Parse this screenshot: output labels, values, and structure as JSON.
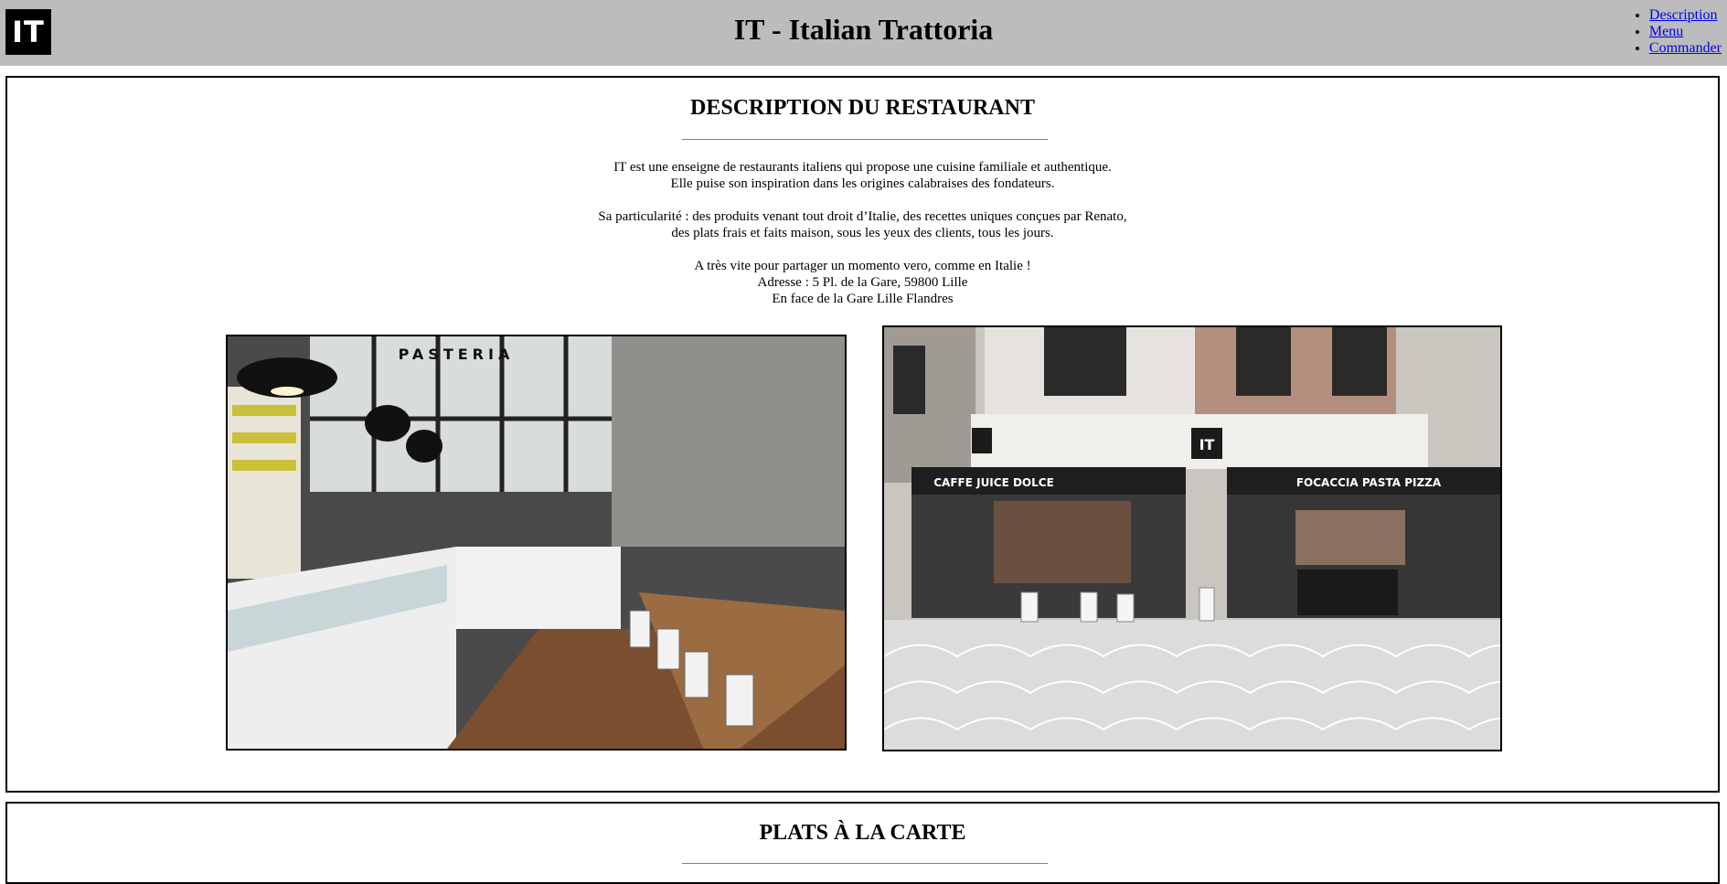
{
  "header": {
    "logo_text": "IT",
    "title": "IT - Italian Trattoria",
    "nav": [
      {
        "label": "Description"
      },
      {
        "label": "Menu"
      },
      {
        "label": "Commander"
      }
    ]
  },
  "description": {
    "title": "DESCRIPTION DU RESTAURANT",
    "lines": [
      "IT est une enseigne de restaurants italiens qui propose une cuisine familiale et authentique.",
      "Elle puise son inspiration dans les origines calabraises des fondateurs.",
      "Sa particularité : des produits venant tout droit d’Italie, des recettes uniques conçues par Renato,",
      "des plats frais et faits maison, sous les yeux des clients, tous les jours.",
      "A très vite pour partager un momento vero, comme en Italie !",
      "Adresse : 5 Pl. de la Gare, 59800 Lille",
      "En face de la Gare Lille Flandres"
    ],
    "photos": {
      "interior_sign": "PASTERIA",
      "facade_sign_left": "CAFFE JUICE DOLCE",
      "facade_sign_right": "FOCACCIA PASTA PIZZA",
      "facade_logo": "IT"
    }
  },
  "plats": {
    "title": "PLATS À LA CARTE"
  }
}
